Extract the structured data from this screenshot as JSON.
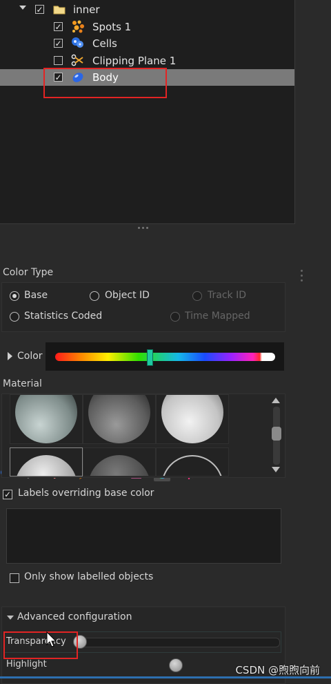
{
  "tree": {
    "items": [
      {
        "label": "inner",
        "checked": true,
        "icon": "folder-icon"
      },
      {
        "label": "Spots 1",
        "checked": true,
        "icon": "spots-icon"
      },
      {
        "label": "Cells",
        "checked": true,
        "icon": "cells-icon"
      },
      {
        "label": "Clipping Plane 1",
        "checked": false,
        "icon": "scissors-icon"
      },
      {
        "label": "Body",
        "checked": true,
        "icon": "surface-icon",
        "selected": true
      }
    ]
  },
  "toolbar": {
    "tools": [
      "cells-tool-icon",
      "magic-wand-icon",
      "paint-brush-icon",
      "pencil-icon",
      "filter-icon",
      "grid-stats-icon",
      "color-wheel-icon",
      "gear-settings-icon"
    ],
    "active": "color-wheel-icon"
  },
  "color_type": {
    "title": "Color Type",
    "options": {
      "base": "Base",
      "object_id": "Object ID",
      "track_id": "Track ID",
      "statistics": "Statistics Coded",
      "time_mapped": "Time Mapped"
    },
    "selected": "Base"
  },
  "color": {
    "label": "Color",
    "hue_position": 0.53
  },
  "material": {
    "title": "Material"
  },
  "labels": {
    "override_label": "Labels overriding base color",
    "override_checked": true,
    "only_labelled": "Only show labelled objects",
    "only_labelled_checked": false
  },
  "advanced": {
    "title": "Advanced configuration",
    "transparency_label": "Transparency",
    "transparency_value": 0.0,
    "highlight_label": "Highlight",
    "highlight_value": 0.5
  },
  "watermark": "CSDN @煦煦向前",
  "colors": {
    "accent_selection": "#7a7a7a",
    "highlight_box": "#e32424",
    "slider_marker": "#1ec8a0"
  }
}
